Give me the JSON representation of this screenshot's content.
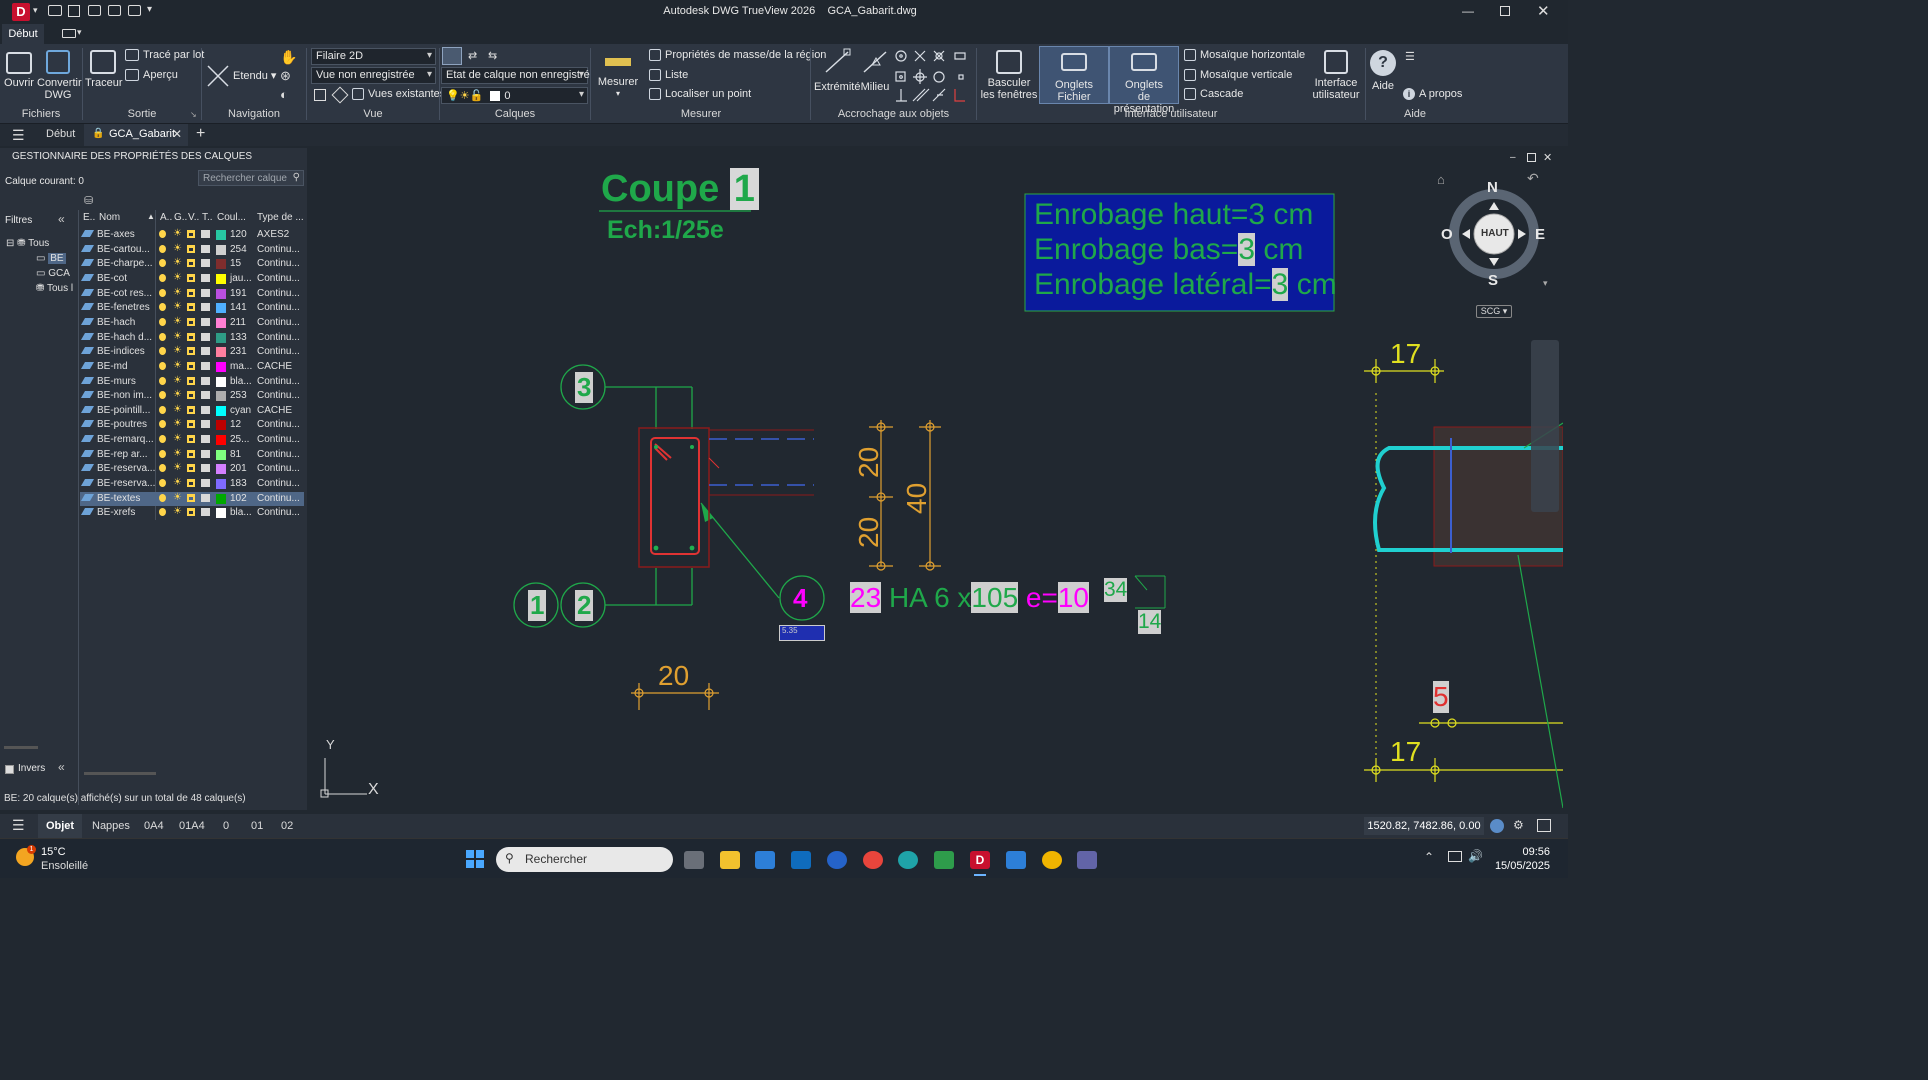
{
  "window": {
    "title": "Autodesk DWG TrueView 2026    GCA_Gabarit.dwg",
    "logo": "D"
  },
  "ribbon": {
    "tab_active": "Début",
    "groups": {
      "fichiers": {
        "title": "Fichiers",
        "open": "Ouvrir",
        "convert_l1": "Convertir",
        "convert_l2": "DWG"
      },
      "sortie": {
        "title": "Sortie",
        "traceur": "Traceur",
        "batch": "Tracé par lot",
        "preview": "Aperçu"
      },
      "navigation": {
        "title": "Navigation",
        "etendu": "Etendu"
      },
      "vue": {
        "title": "Vue",
        "visual_style": "Filaire 2D",
        "named_view": "Vue non enregistrée",
        "views": "Vues existantes"
      },
      "calques": {
        "title": "Calques",
        "layer_state": "Etat de calque non enregistré",
        "current_layer": "0"
      },
      "mesurer": {
        "title": "Mesurer",
        "measure": "Mesurer",
        "mass_props": "Propriétés de masse/de la région",
        "list": "Liste",
        "locate": "Localiser un point"
      },
      "accrochage": {
        "title": "Accrochage aux objets",
        "endpoint": "Extrémité",
        "midpoint": "Milieu"
      },
      "interface": {
        "title": "Interface utilisateur",
        "switch_l1": "Basculer",
        "switch_l2": "les fenêtres",
        "file_tabs": "Onglets Fichier",
        "layout_l1": "Onglets",
        "layout_l2": "de présentation",
        "tile_h": "Mosaïque horizontale",
        "tile_v": "Mosaïque verticale",
        "cascade": "Cascade",
        "ui_l1": "Interface",
        "ui_l2": "utilisateur"
      },
      "aide": {
        "title": "Aide",
        "help": "Aide",
        "about": "A propos"
      }
    }
  },
  "doc_tabs": {
    "start": "Début",
    "current": "GCA_Gabarit"
  },
  "layer_palette": {
    "title": "GESTIONNAIRE DES PROPRIÉTÉS DES CALQUES",
    "current_layer": "Calque courant: 0",
    "search_placeholder": "Rechercher calque",
    "filters_label": "Filtres",
    "tree": [
      "Tous",
      "BE",
      "GCA",
      "Tous l"
    ],
    "invert_label": "Invers",
    "columns": [
      "E..",
      "Nom",
      "A..",
      "G..",
      "V..",
      "T..",
      "Coul...",
      "Type de ..."
    ],
    "layers": [
      {
        "name": "BE-axes",
        "color": "120",
        "swatch": "#27c7a2",
        "linetype": "AXES2"
      },
      {
        "name": "BE-cartou...",
        "color": "254",
        "swatch": "#cfcfcf",
        "linetype": "Continu..."
      },
      {
        "name": "BE-charpe...",
        "color": "15",
        "swatch": "#7f2d2d",
        "linetype": "Continu..."
      },
      {
        "name": "BE-cot",
        "color": "jau...",
        "swatch": "#ffff00",
        "linetype": "Continu..."
      },
      {
        "name": "BE-cot res...",
        "color": "191",
        "swatch": "#b94fe0",
        "linetype": "Continu..."
      },
      {
        "name": "BE-fenetres",
        "color": "141",
        "swatch": "#4fb0ff",
        "linetype": "Continu..."
      },
      {
        "name": "BE-hach",
        "color": "211",
        "swatch": "#ff7fd4",
        "linetype": "Continu..."
      },
      {
        "name": "BE-hach d...",
        "color": "133",
        "swatch": "#2e9c86",
        "linetype": "Continu..."
      },
      {
        "name": "BE-indices",
        "color": "231",
        "swatch": "#ff7f9f",
        "linetype": "Continu..."
      },
      {
        "name": "BE-md",
        "color": "ma...",
        "swatch": "#ff00ff",
        "linetype": "CACHE"
      },
      {
        "name": "BE-murs",
        "color": "bla...",
        "swatch": "#ffffff",
        "linetype": "Continu..."
      },
      {
        "name": "BE-non im...",
        "color": "253",
        "swatch": "#adadad",
        "linetype": "Continu..."
      },
      {
        "name": "BE-pointill...",
        "color": "cyan",
        "swatch": "#00ffff",
        "linetype": "CACHE"
      },
      {
        "name": "BE-poutres",
        "color": "12",
        "swatch": "#bd0000",
        "linetype": "Continu..."
      },
      {
        "name": "BE-remarq...",
        "color": "25...",
        "swatch": "#ff0000",
        "linetype": "Continu..."
      },
      {
        "name": "BE-rep ar...",
        "color": "81",
        "swatch": "#7fff7f",
        "linetype": "Continu..."
      },
      {
        "name": "BE-reserva...",
        "color": "201",
        "swatch": "#d47fff",
        "linetype": "Continu..."
      },
      {
        "name": "BE-reserva...",
        "color": "183",
        "swatch": "#7f6aff",
        "linetype": "Continu..."
      },
      {
        "name": "BE-textes",
        "color": "102",
        "swatch": "#00a800",
        "linetype": "Continu..."
      },
      {
        "name": "BE-xrefs",
        "color": "bla...",
        "swatch": "#ffffff",
        "linetype": "Continu..."
      }
    ],
    "footer": "BE: 20 calque(s) affiché(s) sur un total de 48 calque(s)"
  },
  "drawing": {
    "title_main": "Coupe",
    "title_num": "1",
    "scale": "Ech:1/25e",
    "cover_top": "Enrobage haut=3 cm",
    "cover_bottom_pre": "Enrobage bas=",
    "cover_bottom_val": "3",
    "cover_side_pre": "Enrobage latéral=",
    "cover_side_val": "3",
    "cover_unit": " cm",
    "markers": {
      "m3": "3",
      "m1": "1",
      "m2": "2",
      "m4": "4"
    },
    "dims": {
      "d20a": "20",
      "d20b": "20",
      "d40": "40",
      "d20c": "20",
      "d17a": "17",
      "d17b": "17",
      "d5": "5"
    },
    "rebar": {
      "count": "23",
      "type": "HA 6",
      "x": "x",
      "length": "105",
      "e_label": "e=",
      "spacing": "10"
    },
    "small": {
      "a": "34",
      "b": "14",
      "tiny": "5.35"
    },
    "compass": {
      "n": "N",
      "s": "S",
      "e": "E",
      "w": "O",
      "top": "HAUT",
      "ucs": "SCG"
    },
    "axes": {
      "y": "Y",
      "x": "X"
    }
  },
  "status": {
    "model": "Objet",
    "tabs": [
      "Nappes",
      "0A4",
      "01A4",
      "0",
      "01",
      "02"
    ],
    "coords": "1520.82, 7482.86, 0.00"
  },
  "taskbar": {
    "weather_temp": "15°C",
    "weather_desc": "Ensoleillé",
    "search": "Rechercher",
    "time": "09:56",
    "date": "15/05/2025"
  }
}
